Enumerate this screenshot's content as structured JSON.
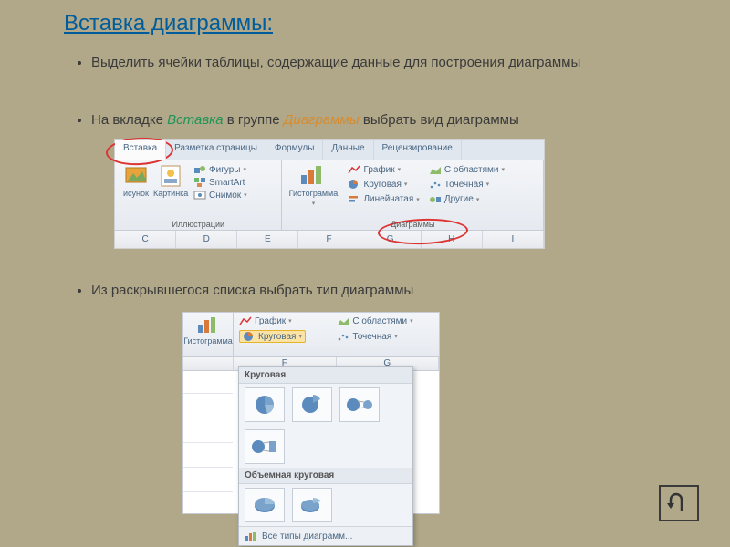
{
  "title": "Вставка диаграммы:",
  "bullets": {
    "b1": "Выделить ячейки таблицы, содержащие данные для построения диаграммы",
    "b2_pre": "На вкладке ",
    "b2_em1": "Вставка",
    "b2_mid": " в группе ",
    "b2_em2": "Диаграммы",
    "b2_post": " выбрать вид диаграммы",
    "b3": "Из раскрывшегося списка выбрать тип диаграммы"
  },
  "ribbon1": {
    "tabs": [
      "Вставка",
      "Разметка страницы",
      "Формулы",
      "Данные",
      "Рецензирование"
    ],
    "group1": {
      "label": "Иллюстрации",
      "btn1": "исунок",
      "btn2": "Картинка",
      "shapes": "Фигуры",
      "smartart": "SmartArt",
      "snapshot": "Снимок"
    },
    "group2": {
      "label": "Диаграммы",
      "histogram": "Гистограмма",
      "items": [
        "График",
        "Круговая",
        "Линейчатая",
        "С областями",
        "Точечная",
        "Другие"
      ]
    },
    "cols": [
      "C",
      "D",
      "E",
      "F",
      "G",
      "H",
      "I"
    ]
  },
  "ribbon2": {
    "histogram": "Гистограмма",
    "items": [
      "График",
      "Круговая",
      "С областями",
      "Точечная"
    ],
    "cols": [
      "F",
      "G"
    ],
    "dd_head1": "Круговая",
    "dd_head2": "Объемная круговая",
    "dd_foot": "Все типы диаграмм..."
  },
  "colors": {
    "accent": "#005c9a",
    "mark": "#d33",
    "select": "#fbe2a5"
  }
}
